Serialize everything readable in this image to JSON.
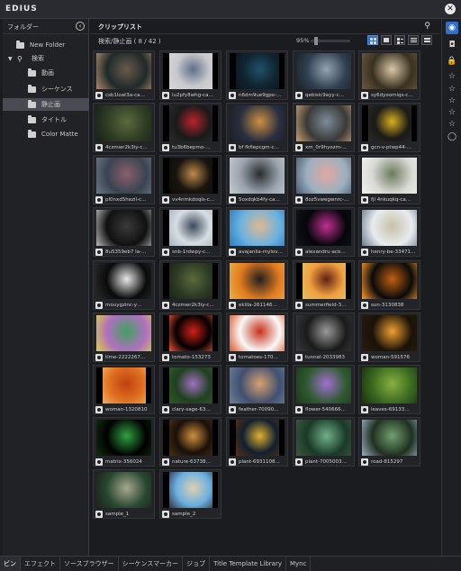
{
  "app": {
    "title": "EDIUS"
  },
  "folder_panel": {
    "title": "フォルダー",
    "items": [
      {
        "label": "New Folder",
        "type": "folder"
      },
      {
        "label": "検索",
        "type": "search"
      },
      {
        "label": "動画",
        "type": "folder"
      },
      {
        "label": "シーケンス",
        "type": "folder"
      },
      {
        "label": "静止画",
        "type": "folder",
        "selected": true
      },
      {
        "label": "タイトル",
        "type": "folder"
      },
      {
        "label": "Color Matte",
        "type": "folder"
      }
    ]
  },
  "clip_panel": {
    "title": "クリップリスト",
    "path": "検索/静止画 ( 8 / 42 )",
    "zoom": "95%",
    "clips": [
      {
        "label": "csb1loat3a-ca…",
        "colors": [
          "#1f2a2a",
          "#6a5a4a",
          "#b58a6a"
        ]
      },
      {
        "label": "lu2pfy8whg-ca…",
        "colors": [
          "#c9c9cc",
          "#5e6f88",
          "#d7d7da"
        ]
      },
      {
        "label": "n6dm9ue9gpo-…",
        "colors": [
          "#0f2530",
          "#22506a",
          "#0c1418"
        ]
      },
      {
        "label": "qebisic9ayy-c…",
        "colors": [
          "#304050",
          "#93a3b0",
          "#1b2024"
        ]
      },
      {
        "label": "sy6dyoomiqs-c…",
        "colors": [
          "#3a3020",
          "#d8c8a8",
          "#6b5a44"
        ]
      },
      {
        "label": "4czmwr2k3iy-c…",
        "colors": [
          "#2e3c25",
          "#5a6b3a",
          "#1a2015"
        ]
      },
      {
        "label": "tu3b6bepmo-…",
        "colors": [
          "#1a1a1a",
          "#b8232a",
          "#2a2a2a"
        ]
      },
      {
        "label": "bf fkfiepcgm-c…",
        "colors": [
          "#2a3040",
          "#d09040",
          "#1a1c22"
        ]
      },
      {
        "label": "xm_0r9hyozm-…",
        "colors": [
          "#3a3a38",
          "#7c8c9a",
          "#c9a070"
        ]
      },
      {
        "label": "gcn-v-ptwp44-…",
        "colors": [
          "#1a1a18",
          "#d8b020",
          "#2a2a28"
        ]
      },
      {
        "label": "pl0nxd5hezil-c…",
        "colors": [
          "#3a4452",
          "#8a5f6a",
          "#6a7a84"
        ]
      },
      {
        "label": "vv4nmkdoqls-c…",
        "colors": [
          "#181410",
          "#c08a4a",
          "#0c0a08"
        ]
      },
      {
        "label": "5oxdqkb4fy-ca…",
        "colors": [
          "#9aa4ae",
          "#2a2c2e",
          "#c4cbd0"
        ]
      },
      {
        "label": "8oz5vwegwnrc-…",
        "colors": [
          "#9cb0c0",
          "#e0a8a0",
          "#4a5870"
        ]
      },
      {
        "label": "fjl 4nkuqkq-ca…",
        "colors": [
          "#d8d8d4",
          "#6a7a5a",
          "#f2f2ee"
        ]
      },
      {
        "label": "8u5359eb7 la-…",
        "colors": [
          "#101010",
          "#3a3a3a",
          "#b8b8b8"
        ]
      },
      {
        "label": "snb-1rdwpy-c…",
        "colors": [
          "#d8dde2",
          "#3a4a5a",
          "#a8b4c0"
        ]
      },
      {
        "label": "avajanlia-mylov…",
        "colors": [
          "#6ab2e0",
          "#e0b890",
          "#2b7ac4"
        ]
      },
      {
        "label": "alexandru-aco…",
        "colors": [
          "#06060a",
          "#c03090",
          "#10141a"
        ]
      },
      {
        "label": "henry-be-33471…",
        "colors": [
          "#e8ecee",
          "#c8c0a8",
          "#6a7a8a"
        ]
      },
      {
        "label": "mouygzinc-y…",
        "colors": [
          "#0a0a0a",
          "#e8e8e8",
          "#2a2a2a"
        ]
      },
      {
        "label": "4czmwr2k3iy-c…",
        "colors": [
          "#2e3c25",
          "#5a6b3a",
          "#1a2015"
        ]
      },
      {
        "label": "ekilla-261146…",
        "colors": [
          "#e07a20",
          "#202020",
          "#f0b040"
        ]
      },
      {
        "label": "summerfield-3…",
        "colors": [
          "#f0a040",
          "#602010",
          "#e8c060"
        ]
      },
      {
        "label": "sun-3130838",
        "colors": [
          "#0a0a0a",
          "#c06010",
          "#ff9a30"
        ]
      },
      {
        "label": "time-2222267…",
        "colors": [
          "#b070c0",
          "#40a060",
          "#e0d040"
        ]
      },
      {
        "label": "tomato-153273",
        "colors": [
          "#000000",
          "#d02018",
          "#f05030"
        ]
      },
      {
        "label": "tomatoes-170…",
        "colors": [
          "#f8f8f8",
          "#c83018",
          "#e05020"
        ]
      },
      {
        "label": "tunnel-2033983",
        "colors": [
          "#1a1a1a",
          "#9a9a9a",
          "#3a3a3a"
        ]
      },
      {
        "label": "woman-591576",
        "colors": [
          "#1a1208",
          "#f0a030",
          "#2a1c10"
        ]
      },
      {
        "label": "woman-1320810",
        "colors": [
          "#e07020",
          "#c04010",
          "#f0b060"
        ]
      },
      {
        "label": "clary-sage-63…",
        "colors": [
          "#204020",
          "#a070c0",
          "#305a2a"
        ]
      },
      {
        "label": "feather-70090…",
        "colors": [
          "#405070",
          "#d8a070",
          "#6a80a0"
        ]
      },
      {
        "label": "flower-540666…",
        "colors": [
          "#305a30",
          "#a070d0",
          "#1a3a1a"
        ]
      },
      {
        "label": "leaves-69133…",
        "colors": [
          "#3a6a20",
          "#88b040",
          "#1a3010"
        ]
      },
      {
        "label": "matrix-356024",
        "colors": [
          "#000000",
          "#30a040",
          "#103010"
        ]
      },
      {
        "label": "nature-63738…",
        "colors": [
          "#1a1008",
          "#d09040",
          "#4a3018"
        ]
      },
      {
        "label": "plant-6931108…",
        "colors": [
          "#102030",
          "#e0b030",
          "#603010"
        ]
      },
      {
        "label": "plant-7005003…",
        "colors": [
          "#1a3a28",
          "#70b088",
          "#3a5a40"
        ]
      },
      {
        "label": "road-815297",
        "colors": [
          "#203020",
          "#70a070",
          "#9ab0c0"
        ]
      },
      {
        "label": "sample_1",
        "colors": [
          "#284830",
          "#a8a890",
          "#1a2018"
        ]
      },
      {
        "label": "sample_2",
        "colors": [
          "#6ab0e0",
          "#e0d0b0",
          "#303040"
        ]
      }
    ]
  },
  "right_bar": {
    "items": [
      {
        "name": "clip-icon",
        "glyph": "◉",
        "active": true
      },
      {
        "name": "camera-icon",
        "glyph": "◘",
        "active": false
      },
      {
        "name": "lock-icon",
        "glyph": "🔒",
        "active": false
      },
      {
        "name": "star-icon-1",
        "glyph": "☆",
        "active": false
      },
      {
        "name": "star-icon-2",
        "glyph": "☆",
        "active": false
      },
      {
        "name": "star-icon-3",
        "glyph": "☆",
        "active": false
      },
      {
        "name": "star-icon-4",
        "glyph": "☆",
        "active": false
      },
      {
        "name": "star-icon-5",
        "glyph": "☆",
        "active": false
      },
      {
        "name": "circle-icon",
        "glyph": "◯",
        "active": false
      }
    ]
  },
  "bottom_tabs": [
    {
      "label": "ビン",
      "active": true
    },
    {
      "label": "エフェクト"
    },
    {
      "label": "ソースブラウザー"
    },
    {
      "label": "シーケンスマーカー"
    },
    {
      "label": "ジョブ"
    },
    {
      "label": "Title Template Library"
    },
    {
      "label": "Mync"
    }
  ]
}
